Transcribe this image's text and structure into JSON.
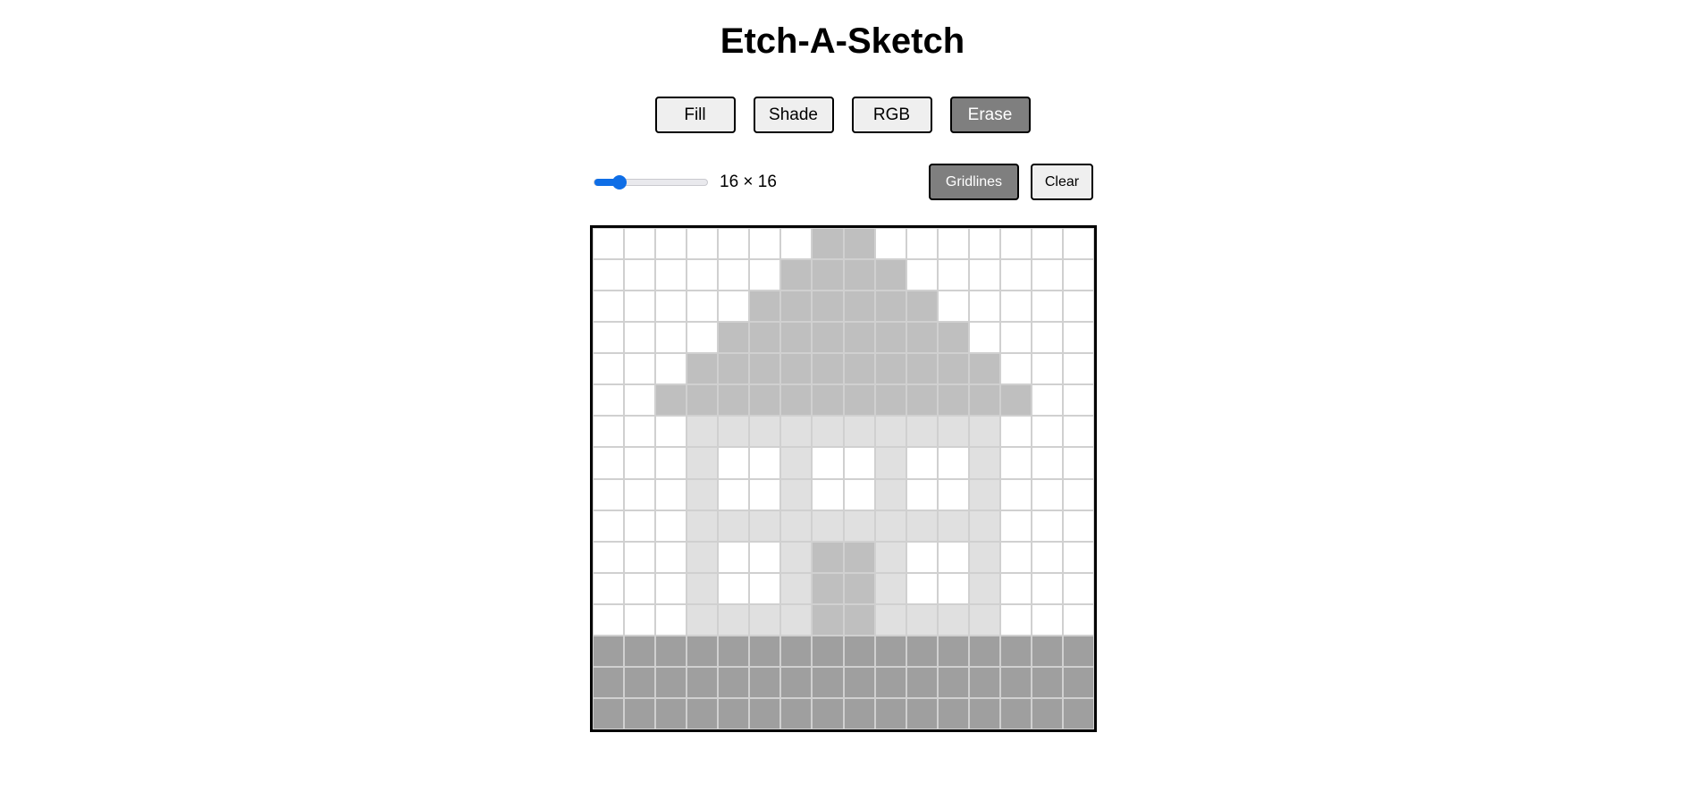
{
  "app": {
    "title": "Etch-A-Sketch"
  },
  "modes": [
    {
      "label": "Fill",
      "active": false
    },
    {
      "label": "Shade",
      "active": false
    },
    {
      "label": "RGB",
      "active": false
    },
    {
      "label": "Erase",
      "active": true
    }
  ],
  "controls": {
    "grid_size": 16,
    "grid_size_min": 2,
    "grid_size_max": 64,
    "size_label": "16 × 16",
    "gridlines_label": "Gridlines",
    "gridlines_active": true,
    "clear_label": "Clear"
  },
  "colors": {
    "accent": "#0f6ee6",
    "active_button": "#7f7f7f",
    "button": "#efefef",
    "gridline": "#d0d0d0"
  },
  "board": {
    "palette": {
      "0": "#ffffff",
      "1": "#e0e0e0",
      "2": "#bfbfbf",
      "3": "#9f9f9f"
    },
    "rows": [
      "0000000220000000",
      "0000002222000000",
      "0000022222200000",
      "0000222222220000",
      "0002222222222000",
      "0022222222222200",
      "0001111111111000",
      "0001001001001000",
      "0001001001001000",
      "0001111111111000",
      "0001001221001000",
      "0001001221001000",
      "0001111221111000",
      "3333333333333333",
      "3333333333333333",
      "3333333333333333"
    ]
  }
}
